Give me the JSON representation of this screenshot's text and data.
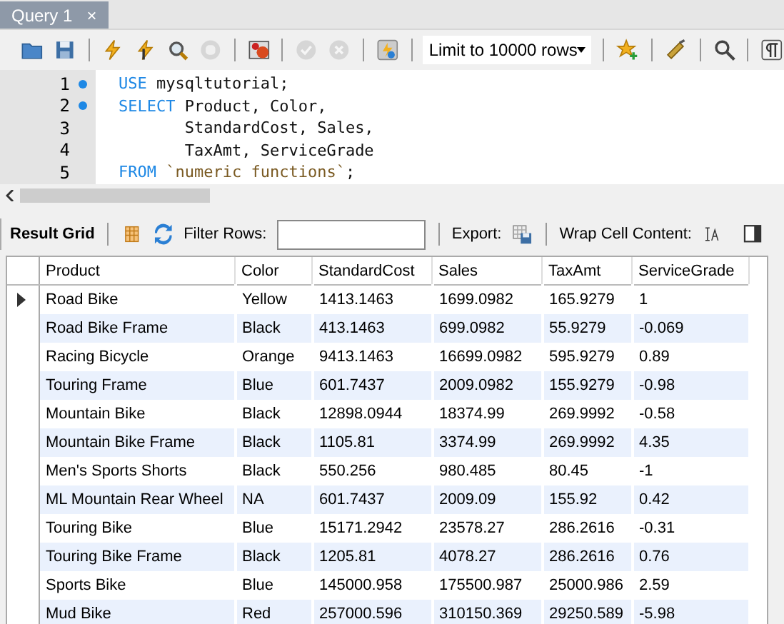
{
  "tab": {
    "title": "Query 1",
    "close": "×"
  },
  "toolbar": {
    "buttons": [
      {
        "disabled": false
      },
      {
        "disabled": false
      },
      {
        "disabled": false
      },
      {
        "disabled": false
      },
      {
        "disabled": false
      },
      {
        "disabled": true
      },
      {
        "disabled": false
      },
      {
        "disabled": true
      },
      {
        "disabled": true
      },
      {
        "disabled": false
      }
    ],
    "limit": "Limit to 10000 rows",
    "tail_buttons": [
      {
        "disabled": false
      },
      {
        "disabled": false
      },
      {
        "disabled": false
      },
      {
        "disabled": false
      }
    ]
  },
  "editor": {
    "lines": [
      {
        "number": "1",
        "marker": true,
        "tokens": [
          {
            "kind": "keyword",
            "text": "USE"
          },
          {
            "kind": "plain",
            "text": " mysqltutorial;"
          }
        ]
      },
      {
        "number": "2",
        "marker": true,
        "tokens": [
          {
            "kind": "keyword",
            "text": "SELECT"
          },
          {
            "kind": "plain",
            "text": " Product, Color,"
          }
        ]
      },
      {
        "number": "3",
        "marker": false,
        "tokens": [
          {
            "kind": "plain",
            "text": "       StandardCost, Sales,"
          }
        ]
      },
      {
        "number": "4",
        "marker": false,
        "tokens": [
          {
            "kind": "plain",
            "text": "       TaxAmt, ServiceGrade"
          }
        ]
      },
      {
        "number": "5",
        "marker": false,
        "tokens": [
          {
            "kind": "keyword",
            "text": "FROM "
          },
          {
            "kind": "string",
            "text": "`numeric functions`"
          },
          {
            "kind": "plain",
            "text": ";"
          }
        ]
      }
    ]
  },
  "result_toolbar": {
    "title": "Result Grid",
    "filter_label": "Filter Rows:",
    "export_label": "Export:",
    "wrap_label": "Wrap Cell Content:"
  },
  "table": {
    "columns": [
      "Product",
      "Color",
      "StandardCost",
      "Sales",
      "TaxAmt",
      "ServiceGrade"
    ],
    "rows": [
      {
        "selected": true,
        "cells": [
          "Road Bike",
          "Yellow",
          "1413.1463",
          "1699.0982",
          "165.9279",
          "1"
        ]
      },
      {
        "selected": false,
        "cells": [
          "Road Bike Frame",
          "Black",
          "413.1463",
          "699.0982",
          "55.9279",
          "-0.069"
        ]
      },
      {
        "selected": false,
        "cells": [
          "Racing Bicycle",
          "Orange",
          "9413.1463",
          "16699.0982",
          "595.9279",
          "0.89"
        ]
      },
      {
        "selected": false,
        "cells": [
          "Touring Frame",
          "Blue",
          "601.7437",
          "2009.0982",
          "155.9279",
          "-0.98"
        ]
      },
      {
        "selected": false,
        "cells": [
          "Mountain Bike",
          "Black",
          "12898.0944",
          "18374.99",
          "269.9992",
          "-0.58"
        ]
      },
      {
        "selected": false,
        "cells": [
          "Mountain Bike Frame",
          "Black",
          "1105.81",
          "3374.99",
          "269.9992",
          "4.35"
        ]
      },
      {
        "selected": false,
        "cells": [
          "Men's Sports Shorts",
          "Black",
          "550.256",
          "980.485",
          "80.45",
          "-1"
        ]
      },
      {
        "selected": false,
        "cells": [
          "ML Mountain Rear Wheel",
          "NA",
          "601.7437",
          "2009.09",
          "155.92",
          "0.42"
        ]
      },
      {
        "selected": false,
        "cells": [
          "Touring Bike",
          "Blue",
          "15171.2942",
          "23578.27",
          "286.2616",
          "-0.31"
        ]
      },
      {
        "selected": false,
        "cells": [
          "Touring Bike Frame",
          "Black",
          "1205.81",
          "4078.27",
          "286.2616",
          "0.76"
        ]
      },
      {
        "selected": false,
        "cells": [
          "Sports Bike",
          "Blue",
          "145000.958",
          "175500.987",
          "25000.986",
          "2.59"
        ]
      },
      {
        "selected": false,
        "cells": [
          "Mud Bike",
          "Red",
          "257000.596",
          "310150.369",
          "29250.589",
          "-5.98"
        ]
      }
    ]
  }
}
